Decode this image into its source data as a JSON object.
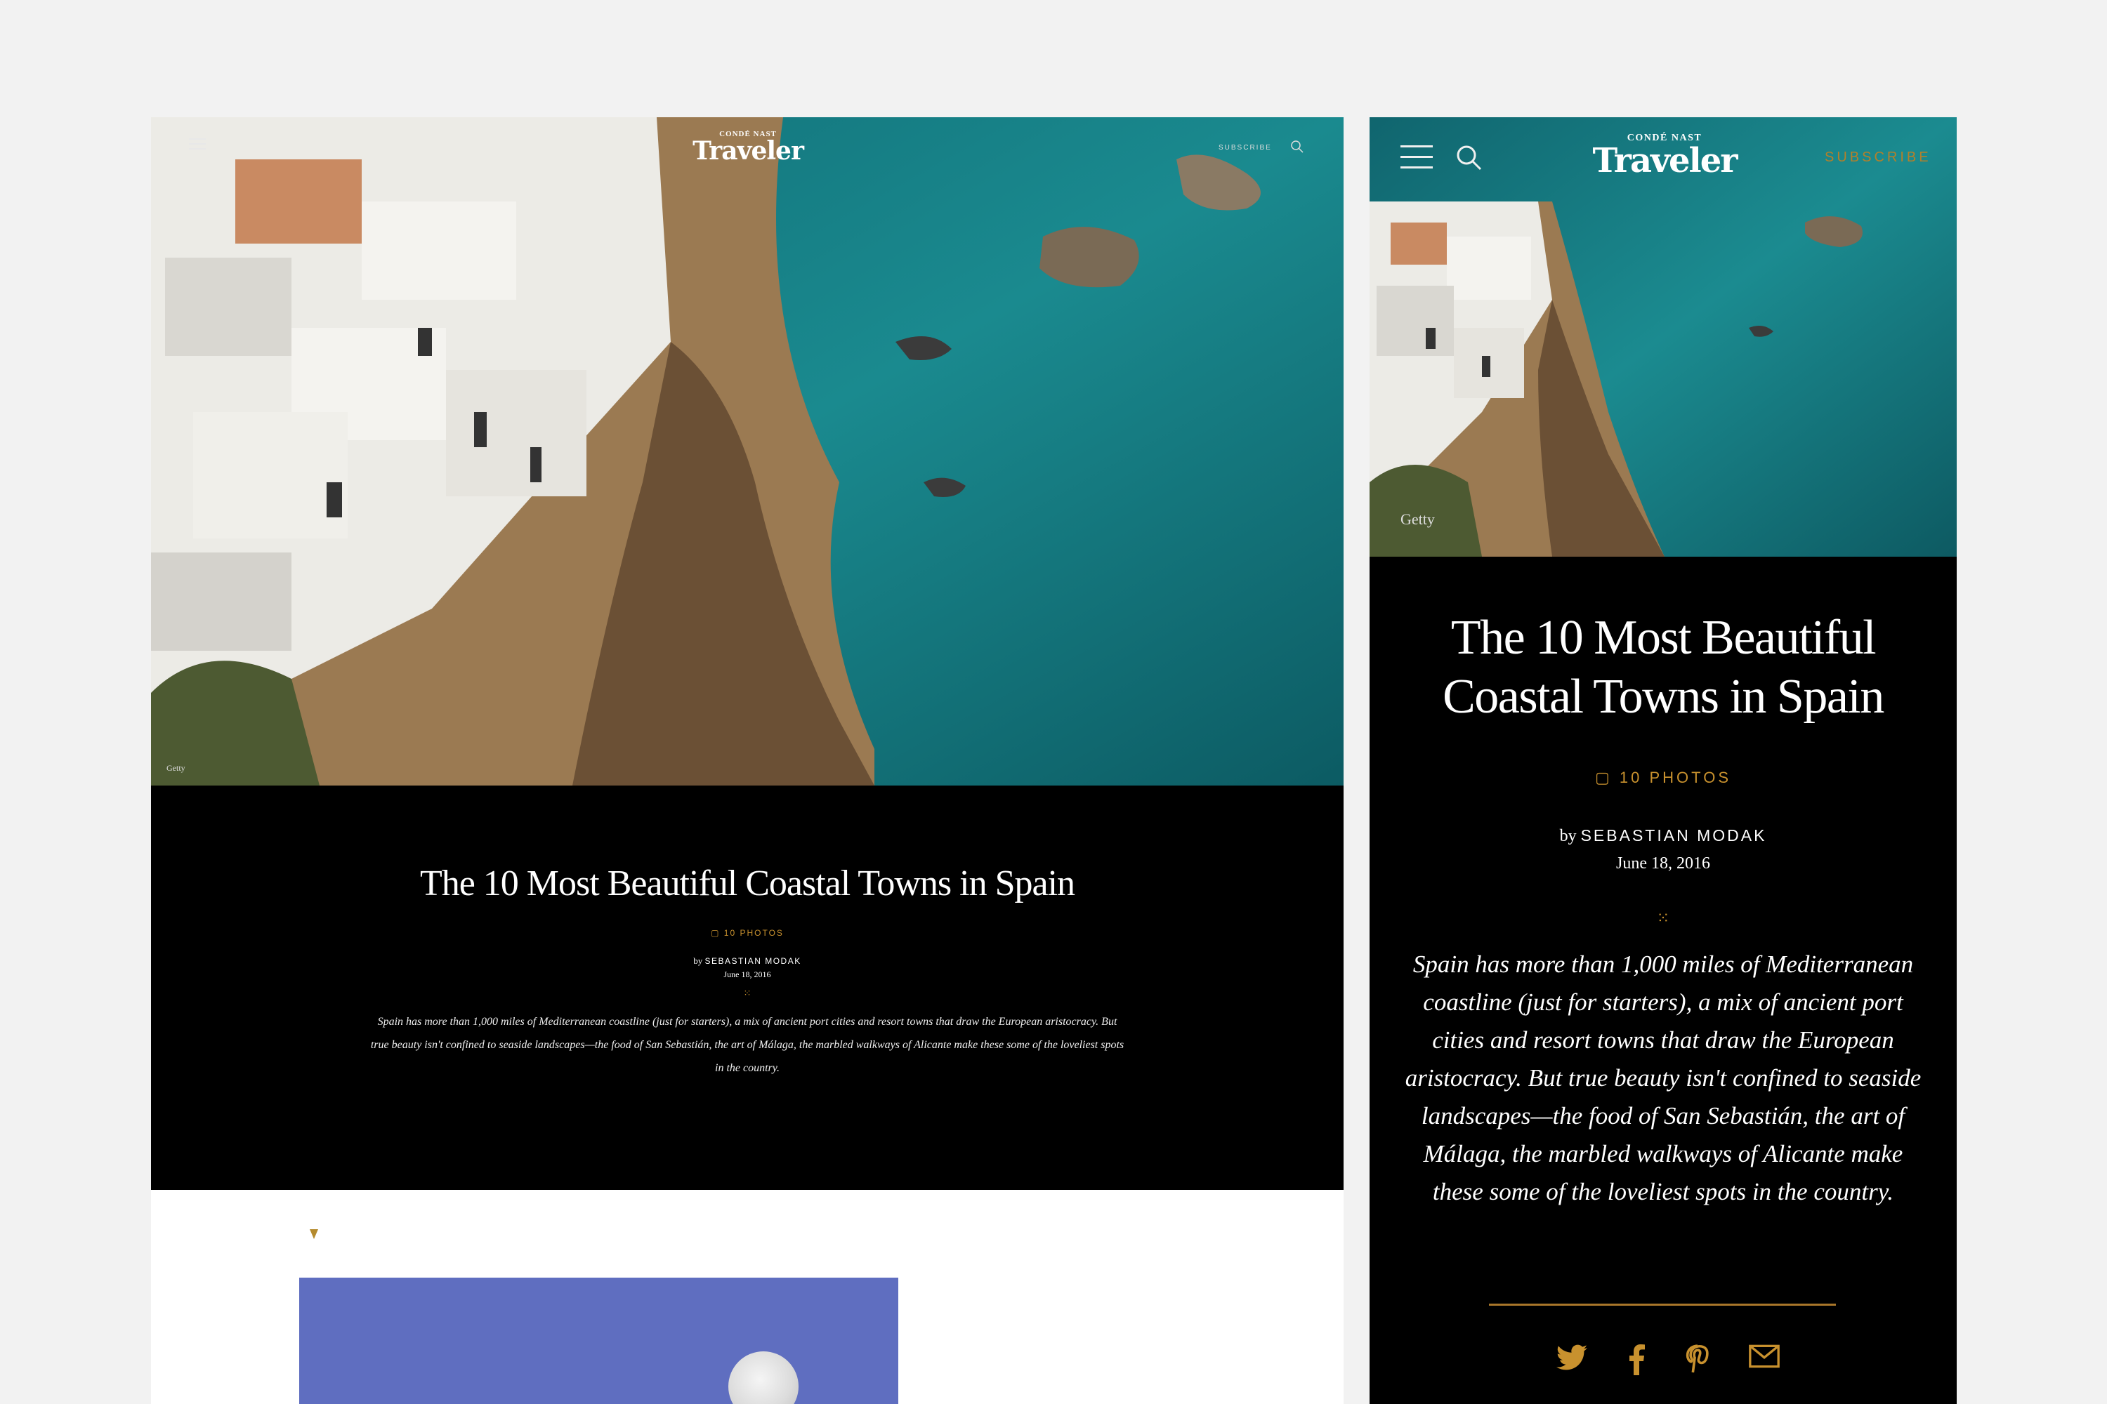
{
  "brand": {
    "top": "CONDÉ NAST",
    "name": "Traveler"
  },
  "nav": {
    "subscribe": "SUBSCRIBE"
  },
  "hero": {
    "credit": "Getty"
  },
  "article": {
    "title": "The 10 Most Beautiful Coastal Towns in Spain",
    "mobile_title_line1": "The 10 Most Beautiful",
    "mobile_title_line2": "Coastal Towns in Spain",
    "photos": "10 PHOTOS",
    "by": "by",
    "author": "SEBASTIAN MODAK",
    "date": "June 18, 2016",
    "ornament": "⁙",
    "description": "Spain has more than 1,000 miles of Mediterranean coastline (just for starters), a mix of ancient port cities and resort towns that draw the European aristocracy. But true beauty isn't confined to seaside landscapes—the food of San Sebastián, the art of Málaga, the marbled walkways of Alicante make these some of the loveliest spots in the country."
  },
  "share": [
    "twitter-icon",
    "facebook-icon",
    "pinterest-icon",
    "email-icon"
  ],
  "colors": {
    "accent": "#c8912e",
    "sea": "#1a7f86",
    "panel": "#000000",
    "page_bg": "#f2f2f2",
    "sky": "#5f6ec0"
  }
}
